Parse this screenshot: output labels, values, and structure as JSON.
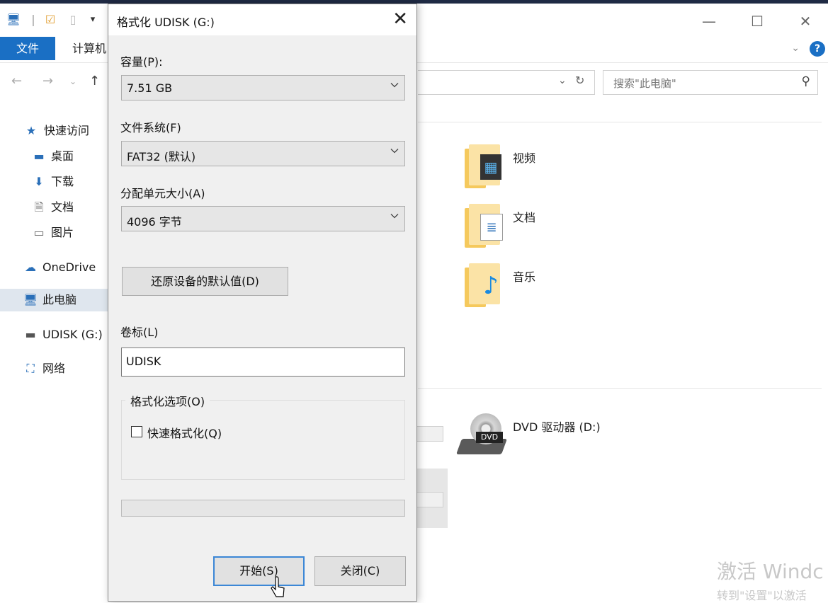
{
  "explorer": {
    "ribbon": {
      "file_tab": "文件",
      "computer_tab": "计算机"
    },
    "search_placeholder": "搜索\"此电脑\"",
    "nav": [
      {
        "label": "快速访问",
        "icon": "star-icon"
      },
      {
        "label": "桌面",
        "icon": "desktop-icon"
      },
      {
        "label": "下载",
        "icon": "download-icon"
      },
      {
        "label": "文档",
        "icon": "document-icon"
      },
      {
        "label": "图片",
        "icon": "picture-icon"
      },
      {
        "label": "OneDrive",
        "icon": "cloud-icon"
      },
      {
        "label": "此电脑",
        "icon": "computer-icon",
        "selected": true
      },
      {
        "label": "UDISK (G:)",
        "icon": "usb-drive-icon"
      },
      {
        "label": "网络",
        "icon": "network-icon"
      }
    ],
    "folders": [
      {
        "label": "视频",
        "icon": "video-folder-icon"
      },
      {
        "label": "文档",
        "icon": "documents-folder-icon"
      },
      {
        "label": "音乐",
        "icon": "music-folder-icon"
      }
    ],
    "devices": [
      {
        "label": "DVD 驱动器 (D:)",
        "icon": "dvd-drive-icon",
        "badge": "DVD"
      }
    ],
    "watermark": {
      "line1": "激活 Windc",
      "line2": "转到\"设置\"以激活"
    }
  },
  "dialog": {
    "title": "格式化 UDISK (G:)",
    "capacity_label": "容量(P):",
    "capacity_value": "7.51 GB",
    "filesystem_label": "文件系统(F)",
    "filesystem_value": "FAT32 (默认)",
    "allocation_label": "分配单元大小(A)",
    "allocation_value": "4096 字节",
    "restore_defaults": "还原设备的默认值(D)",
    "volume_label_label": "卷标(L)",
    "volume_label_value": "UDISK",
    "format_options_label": "格式化选项(O)",
    "quick_format_label": "快速格式化(Q)",
    "quick_format_checked": false,
    "progress": 0,
    "start_button": "开始(S)",
    "close_button": "关闭(C)"
  },
  "colors": {
    "accent": "#1a6fc4",
    "dialog_bg": "#f0f0f0",
    "selected_nav": "#dfe6ee"
  }
}
